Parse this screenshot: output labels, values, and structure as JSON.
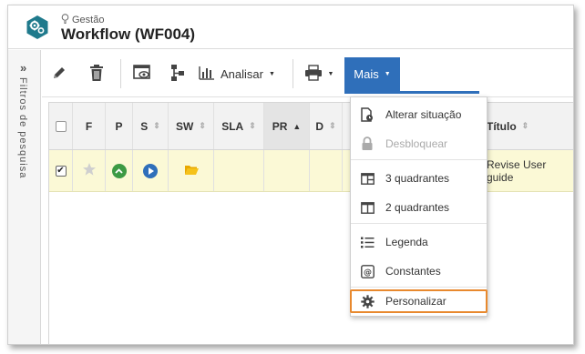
{
  "header": {
    "breadcrumb": "Gestão",
    "title": "Workflow (WF004)"
  },
  "leftpanel": {
    "expand_icon": "double-chevron-right-icon",
    "label": "Filtros de pesquisa"
  },
  "toolbar": {
    "edit_icon": "pencil-icon",
    "delete_icon": "trash-icon",
    "view_icon": "view-window-icon",
    "flow_icon": "flowchart-icon",
    "analisar_label": "Analisar",
    "print_icon": "printer-icon",
    "mais_label": "Mais"
  },
  "grid": {
    "columns": [
      "F",
      "P",
      "S",
      "SW",
      "SLA",
      "PR",
      "D",
      "Título"
    ],
    "sorted_column": "PR",
    "rows": [
      {
        "checked": true,
        "favorite": false,
        "titulo": "Revise User guide"
      }
    ]
  },
  "menu": {
    "items": [
      {
        "label": "Alterar situação",
        "icon": "document-status-icon",
        "disabled": false
      },
      {
        "label": "Desbloquear",
        "icon": "lock-icon",
        "disabled": true
      },
      {
        "label": "3 quadrantes",
        "icon": "three-panel-layout-icon",
        "disabled": false
      },
      {
        "label": "2 quadrantes",
        "icon": "two-panel-layout-icon",
        "disabled": false
      },
      {
        "label": "Legenda",
        "icon": "list-icon",
        "disabled": false
      },
      {
        "label": "Constantes",
        "icon": "at-sign-icon",
        "disabled": false
      },
      {
        "label": "Personalizar",
        "icon": "gear-icon",
        "disabled": false
      }
    ]
  },
  "colors": {
    "accent": "#2f6fba",
    "highlight": "#e8892e",
    "row_bg": "#fbf9d6",
    "logo": "#1f7a8c"
  }
}
